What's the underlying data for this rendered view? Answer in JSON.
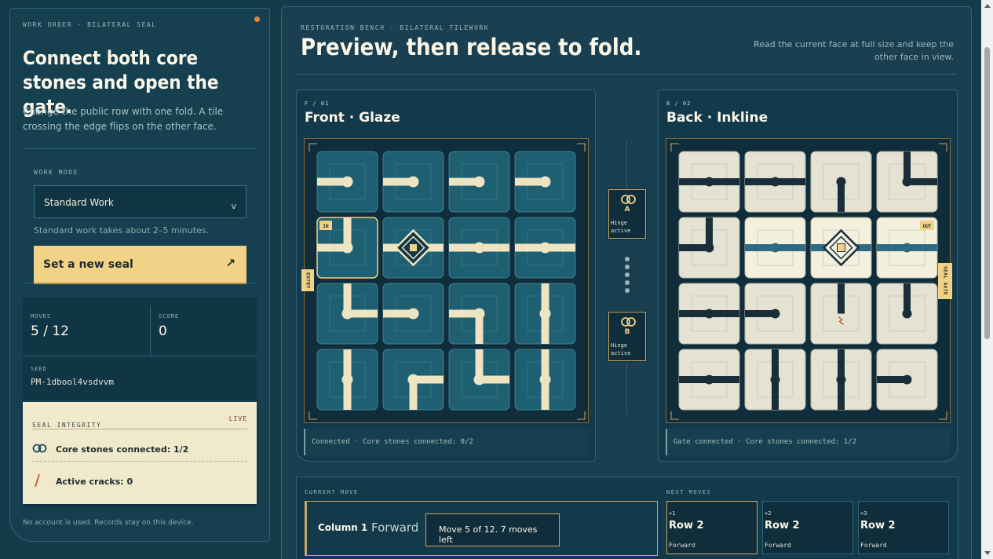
{
  "left": {
    "kicker": "WORK ORDER · BILATERAL SEAL",
    "title": "Connect both core stones and open the gate.",
    "description": "Change the public row with one fold. A tile crossing the edge flips on the other face.",
    "mode_label": "WORK MODE",
    "mode_value": "Standard Work",
    "mode_hint": "Standard work takes about 2–5 minutes.",
    "new_seal_label": "Set a new seal",
    "moves_label": "MOVES",
    "moves_value": "5 / 12",
    "score_label": "SCORE",
    "score_value": "0",
    "seed_label": "SEED",
    "seed_value": "PM-1dbool4vsdvvm",
    "integrity_title": "SEAL INTEGRITY",
    "integrity_live": "LIVE",
    "core_stones": "Core stones connected: 1/2",
    "cracks": "Active cracks: 0",
    "footer": "No account is used. Records stay on this device."
  },
  "main": {
    "kicker": "RESTORATION BENCH · BILATERAL TILEWORK",
    "title": "Preview, then release to fold.",
    "hint": "Read the current face at full size and keep the other face in view."
  },
  "front": {
    "code": "F / 01",
    "name": "Front · Glaze",
    "entry_tag": "ENTRY",
    "in_tag": "IN",
    "status": "Connected · Core stones connected: 0/2"
  },
  "back": {
    "code": "B / 02",
    "name": "Back · Inkline",
    "gate_tag": "SEAL GATE",
    "out_tag": "OUT",
    "status": "Gate connected · Core stones connected: 1/2"
  },
  "hinges": [
    {
      "letter": "A",
      "state_line1": "Hinge",
      "state_line2": "active"
    },
    {
      "letter": "B",
      "state_line1": "Hinge",
      "state_line2": "active"
    }
  ],
  "current_move": {
    "label": "CURRENT MOVE",
    "target": "Column 1",
    "direction": "Forward",
    "tooltip": "Move 5 of 12. 7 moves left"
  },
  "next_moves": {
    "label": "NEXT MOVES",
    "items": [
      {
        "index": "+1",
        "target": "Row 2",
        "direction": "Forward"
      },
      {
        "index": "+2",
        "target": "Row 2",
        "direction": "Forward"
      },
      {
        "index": "+3",
        "target": "Row 2",
        "direction": "Forward"
      }
    ]
  },
  "boards": {
    "front": [
      [
        "end-right",
        "end-right",
        "end-right",
        "end-right"
      ],
      [
        "corner-top-left-in",
        "core",
        "straight-h",
        "straight-h"
      ],
      [
        "corner-top-right",
        "end-right",
        "tee-left",
        "straight-v"
      ],
      [
        "straight-v",
        "corner-bottom-right",
        "corner-top-right-up",
        "straight-v"
      ]
    ],
    "back": [
      [
        "straight-h",
        "straight-h",
        "end-bottom",
        "corner-top-right"
      ],
      [
        "corner-top-left",
        "lit-h",
        "core-lit",
        "lit-h"
      ],
      [
        "straight-h",
        "end-left",
        "end-top-crack",
        "end-top"
      ],
      [
        "straight-h",
        "straight-v",
        "straight-v",
        "end-left"
      ]
    ]
  },
  "colors": {
    "accent_gold": "#f2d287",
    "front_tile": "#1e6072",
    "back_tile": "#e4e2d3",
    "ink": "#1a2e3a",
    "glaze_line": "#efe4c2"
  }
}
